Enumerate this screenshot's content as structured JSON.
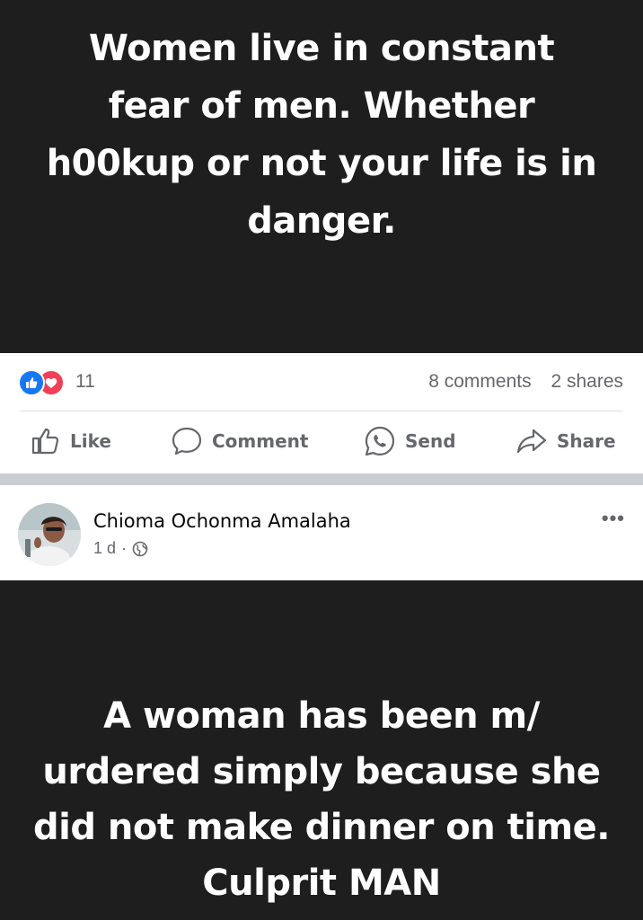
{
  "post_top": {
    "image_caption": "Women live in constant fear of men. Whether h00kup or not your life is in danger."
  },
  "reactions": {
    "icons": [
      "like-reaction-icon",
      "love-reaction-icon"
    ],
    "count": "11",
    "comments": "8 comments",
    "shares": "2 shares"
  },
  "actions": {
    "like": "Like",
    "comment": "Comment",
    "send": "Send",
    "share": "Share"
  },
  "post_second": {
    "author": "Chioma Ochonma Amalaha",
    "time": "1 d",
    "separator": "·",
    "privacy_icon": "globe-icon",
    "more": "•••",
    "image_caption": "A woman has been m/ urdered simply because she did not make  dinner on time. Culprit MAN"
  },
  "colors": {
    "dark_background": "#1e1e1e",
    "like_blue": "#1877f2",
    "love_red": "#f33e58",
    "secondary_text": "#65676b"
  }
}
